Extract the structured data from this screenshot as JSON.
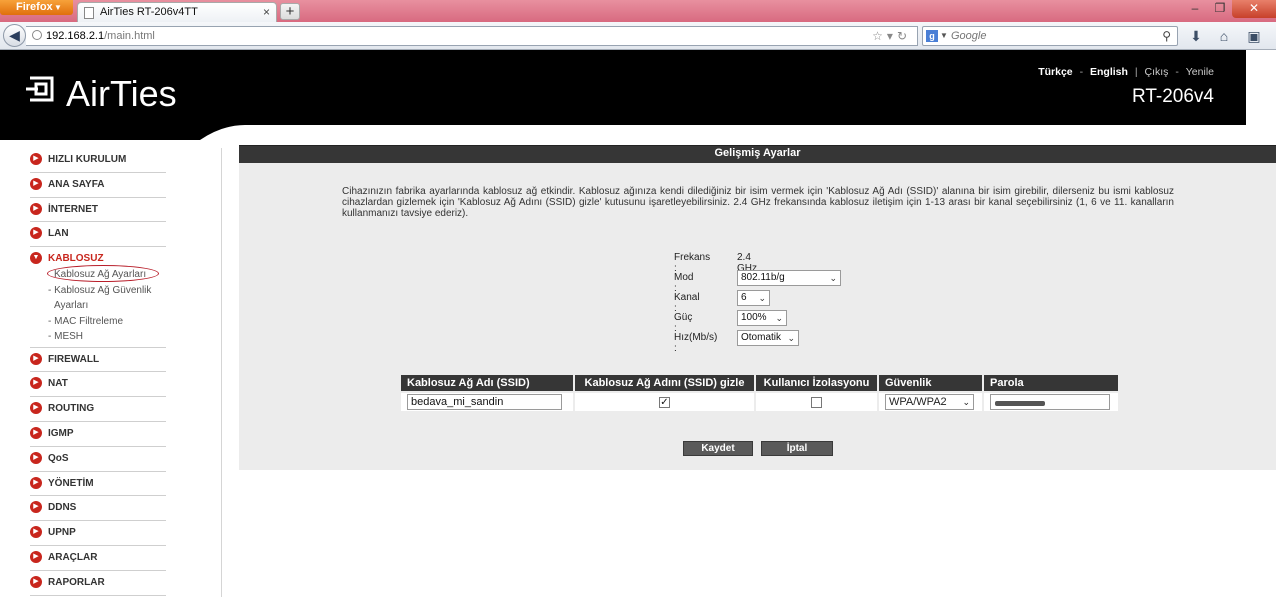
{
  "browser": {
    "menu_button": "Firefox",
    "tab_title": "AirTies RT-206v4TT",
    "new_tab": "+",
    "url_host": "192.168.2.1",
    "url_path": "/main.html",
    "search_placeholder": "Google"
  },
  "header": {
    "brand": "AirTies",
    "lang_tr": "Türkçe",
    "lang_en": "English",
    "logout": "Çıkış",
    "refresh": "Yenile",
    "model": "RT-206v4"
  },
  "sidebar": {
    "items_top": [
      {
        "label": "HIZLI KURULUM"
      },
      {
        "label": "ANA SAYFA"
      },
      {
        "label": "İNTERNET"
      },
      {
        "label": "LAN"
      }
    ],
    "active": {
      "label": "KABLOSUZ"
    },
    "subitems": [
      {
        "label": "Kablosuz Ağ Ayarları"
      },
      {
        "label": "Kablosuz Ağ Güvenlik"
      },
      {
        "label": "Ayarları"
      },
      {
        "label": "MAC Filtreleme"
      },
      {
        "label": "MESH"
      }
    ],
    "items_bottom": [
      {
        "label": "FIREWALL"
      },
      {
        "label": "NAT"
      },
      {
        "label": "ROUTING"
      },
      {
        "label": "IGMP"
      },
      {
        "label": "QoS"
      },
      {
        "label": "YÖNETİM"
      },
      {
        "label": "DDNS"
      },
      {
        "label": "UPNP"
      },
      {
        "label": "ARAÇLAR"
      },
      {
        "label": "RAPORLAR"
      }
    ]
  },
  "panel": {
    "title": "Gelişmiş Ayarlar",
    "intro": "Cihazınızın fabrika ayarlarında kablosuz ağ etkindir. Kablosuz ağınıza kendi dilediğiniz bir isim vermek için 'Kablosuz Ağ Adı (SSID)' alanına bir isim girebilir, dilerseniz bu ismi kablosuz cihazlardan gizlemek için 'Kablosuz Ağ Adını (SSID) gizle' kutusunu işaretleyebilirsiniz. 2.4 GHz frekansında kablosuz iletişim için 1-13 arası bir kanal seçebilirsiniz (1, 6 ve 11. kanalların kullanmanızı tavsiye ederiz).",
    "settings": {
      "frequency_label": "Frekans :",
      "frequency_value": "2.4 GHz",
      "mode_label": "Mod :",
      "mode_value": "802.11b/g",
      "channel_label": "Kanal :",
      "channel_value": "6",
      "power_label": "Güç :",
      "power_value": "100%",
      "speed_label": "Hız(Mb/s) :",
      "speed_value": "Otomatik"
    },
    "table": {
      "headers": [
        "Kablosuz Ağ Adı (SSID)",
        "Kablosuz Ağ Adını (SSID) gizle",
        "Kullanıcı İzolasyonu",
        "Güvenlik",
        "Parola"
      ],
      "ssid": "bedava_mi_sandin",
      "hide_ssid": true,
      "isolation": false,
      "security": "WPA/WPA2"
    },
    "save": "Kaydet",
    "cancel": "İptal"
  }
}
